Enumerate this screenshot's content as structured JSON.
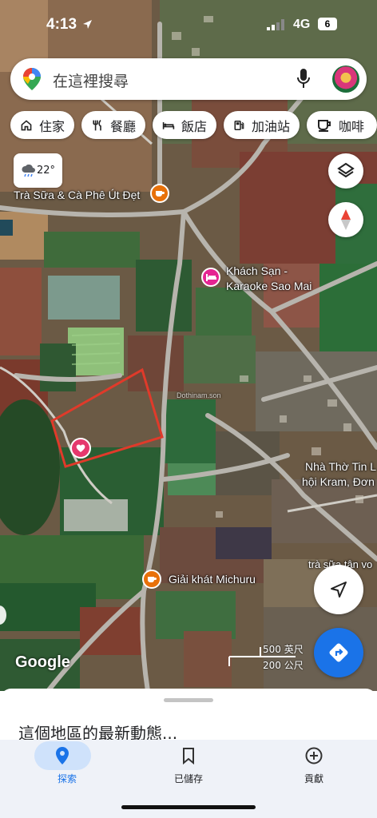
{
  "status_bar": {
    "time": "4:13",
    "network": "4G",
    "battery": "6"
  },
  "search": {
    "placeholder": "在這裡搜尋"
  },
  "chips": [
    {
      "label": "住家",
      "icon": "home-icon"
    },
    {
      "label": "餐廳",
      "icon": "restaurant-icon"
    },
    {
      "label": "飯店",
      "icon": "hotel-icon"
    },
    {
      "label": "加油站",
      "icon": "gas-station-icon"
    },
    {
      "label": "咖啡",
      "icon": "coffee-icon"
    }
  ],
  "weather": {
    "temp": "22°",
    "icon": "cloudy-rain-icon"
  },
  "map": {
    "places": [
      {
        "name": "Trà Sữa & Cà Phê Út Đẹt",
        "icon": "cafe-icon",
        "color": "#e8710a"
      },
      {
        "name_line1": "Khách Sạn -",
        "name_line2": "Karaoke Sao Mai",
        "icon": "hotel-icon",
        "color": "#e52592"
      },
      {
        "name_line1": "Nhà Thờ Tin L",
        "name_line2": "hội Kram, Đơn",
        "icon": "church-icon"
      },
      {
        "name": "trà sữa tân vo",
        "icon": "cafe-icon"
      },
      {
        "name": "Giải khát Michuru",
        "icon": "cafe-icon",
        "color": "#e8710a"
      }
    ],
    "watermark": "Dothinam.son",
    "saved_pin_color": "#e5386d",
    "parcel_outline_color": "#e03a2a",
    "scale": {
      "imperial": "500 英尺",
      "metric": "200 公尺"
    },
    "logo": "Google"
  },
  "sheet": {
    "title": "這個地區的最新動態..."
  },
  "bottom_nav": [
    {
      "label": "探索",
      "icon": "explore-pin-icon",
      "active": true
    },
    {
      "label": "已儲存",
      "icon": "bookmark-icon",
      "active": false
    },
    {
      "label": "貢獻",
      "icon": "add-circle-icon",
      "active": false
    }
  ],
  "colors": {
    "accent": "#1a73e8",
    "nav_bg": "#eff2f8",
    "active_pill": "#cfe2fb"
  }
}
